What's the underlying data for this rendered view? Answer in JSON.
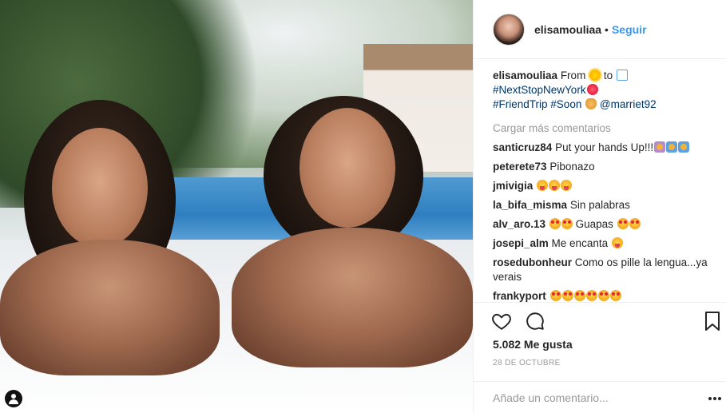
{
  "header": {
    "username": "elisamouliaa",
    "separator": "•",
    "follow_label": "Seguir"
  },
  "caption": {
    "username": "elisamouliaa",
    "text_from": "From",
    "text_to": "to",
    "tag_newyork": "#NextStopNewYork",
    "tag_friendtrip": "#FriendTrip",
    "tag_soon": "#Soon",
    "mention": "@marriet92",
    "icons": [
      "sun-emoji",
      "snowflake-emoji",
      "heart-emoji",
      "ok-hand-emoji"
    ]
  },
  "load_more_label": "Cargar más comentarios",
  "comments": [
    {
      "user": "santicruz84",
      "text": "Put your hands Up!!!"
    },
    {
      "user": "peterete73",
      "text": "Pibonazo"
    },
    {
      "user": "jmivigia",
      "text": ""
    },
    {
      "user": "la_bifa_misma",
      "text": "Sin palabras"
    },
    {
      "user": "alv_aro.13",
      "text": "Guapas"
    },
    {
      "user": "josepi_alm",
      "text": "Me encanta"
    },
    {
      "user": "rosedubonheur",
      "text": "Como os pille la lengua...ya verais"
    },
    {
      "user": "frankyport",
      "text": ""
    }
  ],
  "likes_text": "5.082 Me gusta",
  "date_text": "28 DE OCTUBRE",
  "add_comment_placeholder": "Añade un comentario...",
  "colors": {
    "link": "#3897f0",
    "hashtag": "#003569",
    "muted": "#999999",
    "text": "#262626"
  }
}
